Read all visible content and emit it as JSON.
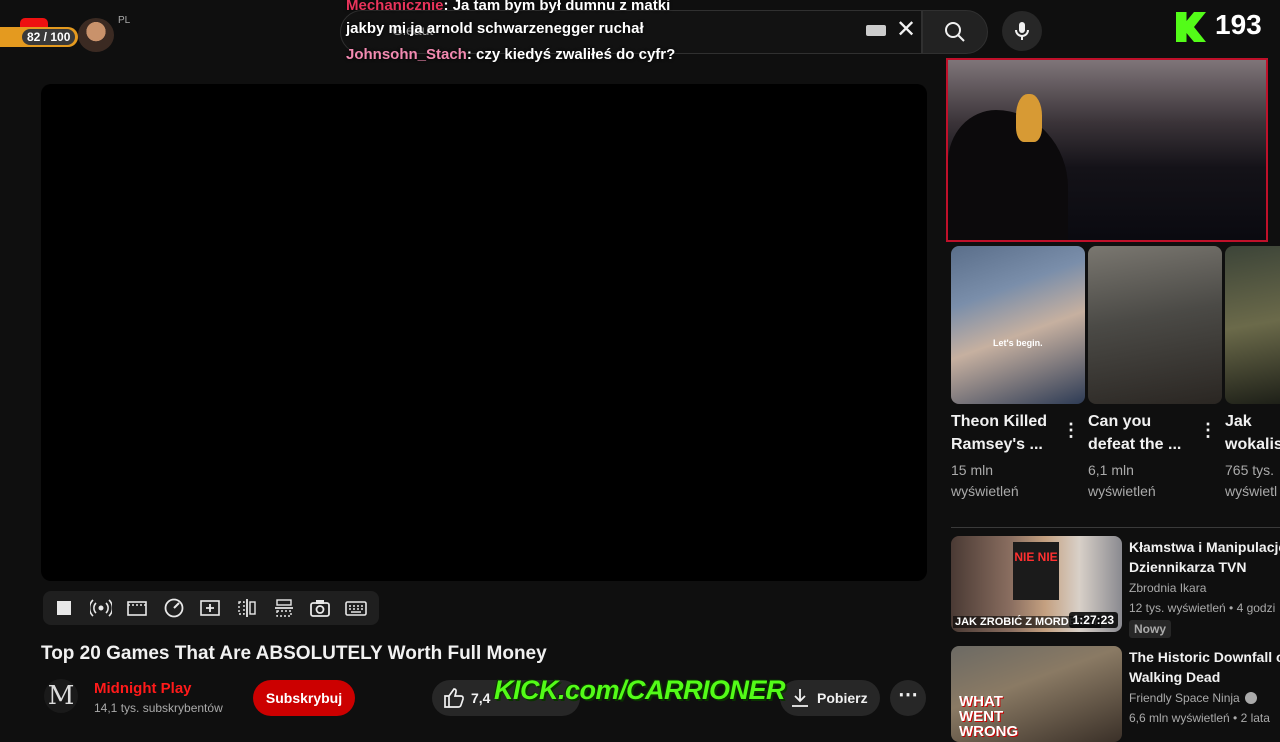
{
  "topbar": {
    "lang": "PL",
    "xp": "82 / 100",
    "search_value": "Gleaut",
    "kick_count": "193"
  },
  "chat": [
    {
      "user": "Mechanicznie",
      "msg": ": Ja tam bym był dumnu z matki"
    },
    {
      "user": "",
      "msg": "jakby mi ja arnold schwarzenegger ruchał"
    },
    {
      "user": "Johnsohn_Stach",
      "msg": ": czy kiedyś zwaliłeś do cyfr?"
    }
  ],
  "video": {
    "title": "Top 20 Games That Are ABSOLUTELY Worth Full Money",
    "channel": "Midnight Play",
    "channel_initial": "M",
    "subscribers": "14,1 tys. subskrybentów",
    "subscribe_label": "Subskrybuj",
    "likes": "7,4",
    "download_label": "Pobierz",
    "more": "⋯"
  },
  "overlay": {
    "kick_banner": "KICK.com/CARRIONER"
  },
  "shorts": [
    {
      "title_line1": "Theon Killed",
      "title_line2": "Ramsey's ...",
      "views_line1": "15 mln",
      "views_line2": "wyświetleń",
      "caption": "Let's begin."
    },
    {
      "title_line1": "Can you",
      "title_line2": "defeat the ...",
      "views_line1": "6,1 mln",
      "views_line2": "wyświetleń"
    },
    {
      "title_line1": "Jak",
      "title_line2": "wokalis",
      "views_line1": "765 tys.",
      "views_line2": "wyświetl"
    }
  ],
  "related": [
    {
      "title_line1": "Kłamstwa i Manipulacje",
      "title_line2": "Dziennikarza TVN",
      "channel": "Zbrodnia Ikara",
      "meta": "12 tys. wyświetleń • 4 godzi",
      "duration": "1:27:23",
      "badge": "Nowy",
      "thumb_text": "JAK ZROBIĆ Z MORDERCY",
      "thumb_sign": "NIE NIE"
    },
    {
      "title_line1": "The Historic Downfall of",
      "title_line2": "Walking Dead",
      "channel": "Friendly Space Ninja",
      "meta": "6,6 mln wyświetleń • 2 lata",
      "thumb_text": "WHAT WENT WRONG"
    }
  ],
  "colors": {
    "bg": "#0f0f0f",
    "subscribe": "#cc0000",
    "kick": "#53fc18",
    "channel_name": "#ff1a1a",
    "webcam_border": "#c0102a"
  }
}
